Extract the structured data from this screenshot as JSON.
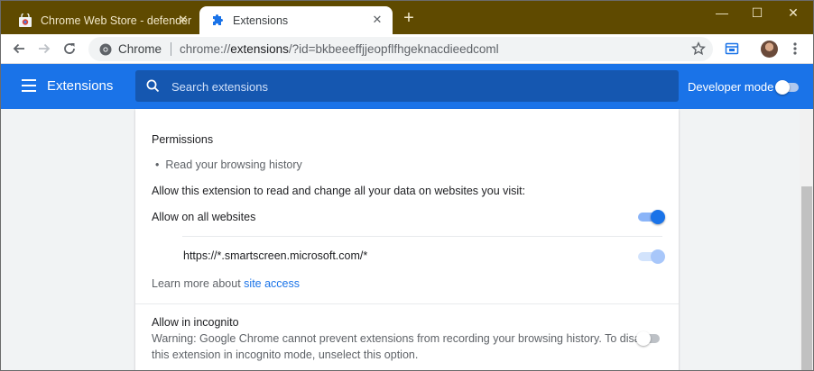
{
  "browser": {
    "tabs": [
      {
        "title": "Chrome Web Store - defender",
        "icon": "chrome-web-store-icon",
        "active": false
      },
      {
        "title": "Extensions",
        "icon": "puzzle-piece-icon",
        "active": true
      }
    ],
    "window_controls": {
      "minimize": "—",
      "maximize": "☐",
      "close": "✕"
    },
    "omnibox": {
      "site_label": "Chrome",
      "url_prefix": "chrome://",
      "url_host": "extensions",
      "url_rest": "/?id=bkbeeeffjjeopflfhgeknacdieedcoml"
    }
  },
  "header": {
    "title": "Extensions",
    "search_placeholder": "Search extensions",
    "developer_mode_label": "Developer mode",
    "developer_mode_on": false
  },
  "details": {
    "permissions_heading": "Permissions",
    "permissions": [
      "Read your browsing history"
    ],
    "site_access_heading": "Allow this extension to read and change all your data on websites you visit:",
    "allow_all_label": "Allow on all websites",
    "allow_all_on": true,
    "site_url": "https://*.smartscreen.microsoft.com/*",
    "site_url_on": true,
    "learn_more_prefix": "Learn more about",
    "learn_more_link": "site access",
    "incognito_label": "Allow in incognito",
    "incognito_warning_line1": "Warning: Google Chrome cannot prevent extensions from recording your browsing history. To disable",
    "incognito_warning_line2": "this extension in incognito mode, unselect this option.",
    "incognito_on": false
  },
  "colors": {
    "titlebar": "#5f4a00",
    "accent": "#1a73e8",
    "search_bg": "#1557b0"
  }
}
